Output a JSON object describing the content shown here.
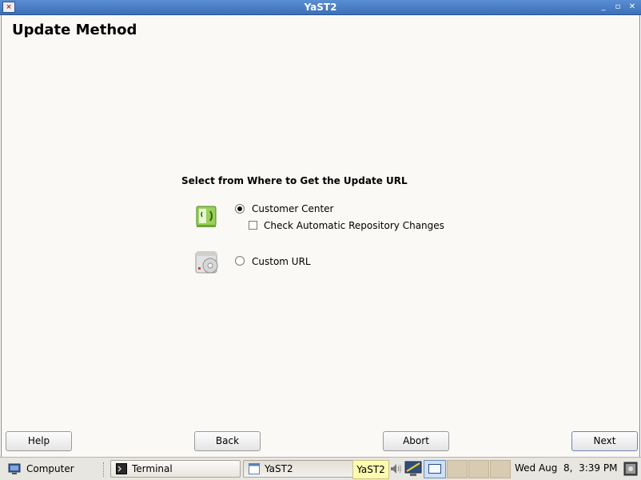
{
  "window": {
    "title": "YaST2",
    "controls": [
      "_",
      "▫",
      "✕"
    ]
  },
  "page": {
    "title": "Update Method",
    "section_heading": "Select from Where to Get the Update URL"
  },
  "options": {
    "customer_center": {
      "label": "Customer Center",
      "selected": true
    },
    "check_repo": {
      "label": "Check Automatic Repository Changes",
      "checked": false
    },
    "custom_url": {
      "label": "Custom URL",
      "selected": false
    }
  },
  "buttons": {
    "help": "Help",
    "back": "Back",
    "abort": "Abort",
    "next": "Next"
  },
  "taskbar": {
    "computer": "Computer",
    "terminal": "Terminal",
    "yast_window": "YaST2",
    "tooltip": "YaST2",
    "clock": "Wed Aug  8,  3:39 PM"
  },
  "colors": {
    "titlebar": "#4a80c8",
    "window_bg": "#fbf9f6",
    "taskbar_bg": "#e8e6e1",
    "tooltip_bg": "#fffcb0"
  }
}
